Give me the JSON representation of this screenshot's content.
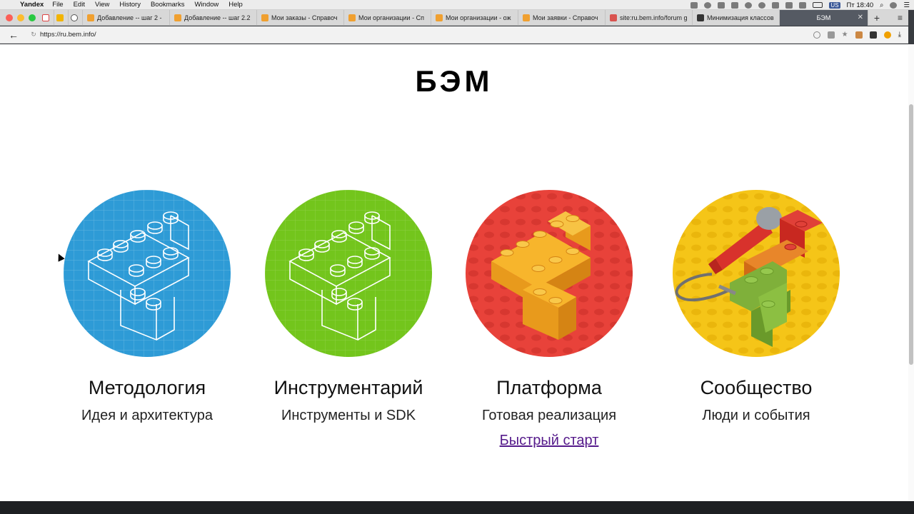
{
  "menubar": {
    "app_name": "Yandex",
    "items": [
      "File",
      "Edit",
      "View",
      "History",
      "Bookmarks",
      "Window",
      "Help"
    ],
    "clock": "Пт 18:40",
    "lang": "US"
  },
  "tabs": [
    {
      "title": "Добавление -- шаг 2 -",
      "color": "#f0a030"
    },
    {
      "title": "Добавление -- шаг 2.2",
      "color": "#f0a030"
    },
    {
      "title": "Мои заказы - Справоч",
      "color": "#f0a030"
    },
    {
      "title": "Мои организации - Сп",
      "color": "#f0a030"
    },
    {
      "title": "Мои организации - ож",
      "color": "#f0a030"
    },
    {
      "title": "Мои заявки - Справоч",
      "color": "#f0a030"
    },
    {
      "title": "site:ru.bem.info/forum g",
      "color": "#d9534f"
    },
    {
      "title": "Минимизация классов",
      "color": "#333333"
    }
  ],
  "active_tab": {
    "title": "БЭМ"
  },
  "address": {
    "url": "https://ru.bem.info/"
  },
  "site": {
    "title": "БЭМ",
    "cards": [
      {
        "title": "Методология",
        "subtitle": "Идея и архитектура",
        "color": "#2e9bd6"
      },
      {
        "title": "Инструментарий",
        "subtitle": "Инструменты и SDK",
        "color": "#73c51c"
      },
      {
        "title": "Платформа",
        "subtitle": "Готовая реализация",
        "link": "Быстрый старт",
        "color": "#e8423a"
      },
      {
        "title": "Сообщество",
        "subtitle": "Люди и события",
        "color": "#f5c518"
      }
    ]
  }
}
